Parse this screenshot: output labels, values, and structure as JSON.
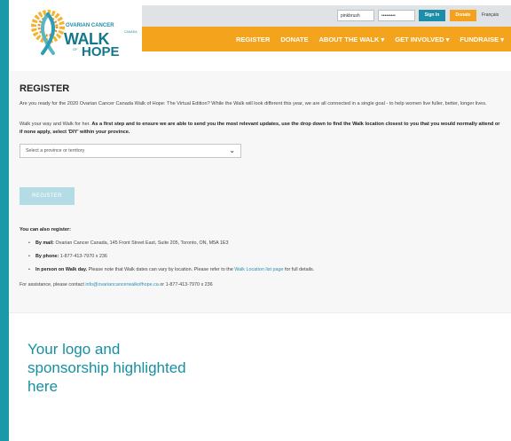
{
  "header": {
    "logo": {
      "line1": "OVARIAN CANCER",
      "line2": "CANADA",
      "line3": "WALK",
      "line4": "OF",
      "line5": "HOPE"
    },
    "login": {
      "username_value": "pinkbrush",
      "password_value": "•••••••••",
      "signin_label": "Sign In",
      "donate_label": "Donate",
      "language_label": "Français"
    },
    "nav": [
      {
        "label": "REGISTER"
      },
      {
        "label": "DONATE"
      },
      {
        "label": "ABOUT THE WALK ▾"
      },
      {
        "label": "GET INVOLVED ▾"
      },
      {
        "label": "FUNDRAISE ▾"
      }
    ]
  },
  "content": {
    "title": "REGISTER",
    "intro": "Are you ready for the 2020 Ovarian Cancer Canada Walk of Hope: The Virtual Edition? While the Walk will look different this year, we are all connected in a single goal - to help women live fuller, better, longer lives.",
    "instruction_plain": "Walk your way and Walk for her. ",
    "instruction_bold": "As a first step and to ensure we are able to send you the most relevant updates, use the drop down to find the Walk location closest to you that you would normally attend or if none apply, select 'DIY' within your province.",
    "select_value": "Select a province or territory",
    "register_label": "REGISTER",
    "also_heading": "You can also register:",
    "options": [
      {
        "bold": "By mail:",
        "text": " Ovarian Cancer Canada, 145 Front Street East, Suite 205, Toronto, ON, M5A 1E3"
      },
      {
        "bold": "By phone:",
        "text": " 1-877-413-7970 x 236"
      },
      {
        "bold": "In person on Walk day.",
        "text": " Please note that Walk dates can vary by location. Please refer to the ",
        "link": "Walk Location list page",
        "after": " for full details."
      }
    ],
    "assist_prefix": "For assistance, please contact ",
    "assist_email": "info@ovariancancerwalkofhope.ca",
    "assist_suffix": " or 1-877-413-7970 x 236"
  },
  "promo": {
    "text": "Your logo and sponsorship highlighted here"
  },
  "colors": {
    "frame": "#1a9aa8",
    "nav": "#f3a31c",
    "brand": "#13788c"
  }
}
